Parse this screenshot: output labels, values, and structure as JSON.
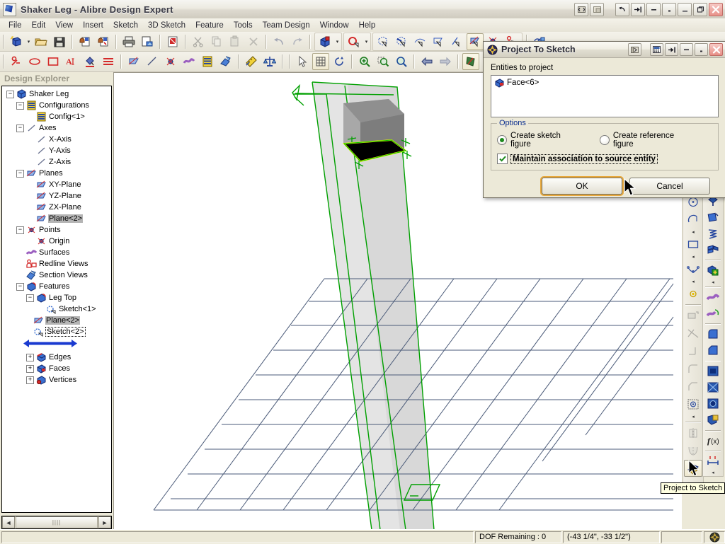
{
  "window": {
    "title": "Shaker Leg - Alibre Design Expert",
    "icon": "alibre-app-icon",
    "buttons": [
      "restore-split",
      "restore-window",
      "undo-arrow",
      "redo-pin",
      "minimize-small",
      "restore-small",
      "minimize",
      "maximize",
      "close"
    ]
  },
  "menubar": {
    "items": [
      {
        "label": "File",
        "key": "F"
      },
      {
        "label": "Edit",
        "key": "E"
      },
      {
        "label": "View",
        "key": "V"
      },
      {
        "label": "Insert",
        "key": "I"
      },
      {
        "label": "Sketch",
        "key": "k"
      },
      {
        "label": "3D Sketch",
        "key": "3"
      },
      {
        "label": "Feature",
        "key": "t"
      },
      {
        "label": "Tools",
        "key": "o"
      },
      {
        "label": "Team Design",
        "key": "D"
      },
      {
        "label": "Window",
        "key": "W"
      },
      {
        "label": "Help",
        "key": "H"
      }
    ]
  },
  "toolbar_row1": {
    "buttons": [
      {
        "name": "new-part-icon",
        "tooltip": "New"
      },
      {
        "name": "new-dropdown-caret",
        "tooltip": "New options"
      },
      {
        "name": "open-folder-icon",
        "tooltip": "Open"
      },
      {
        "name": "save-disk-icon",
        "tooltip": "Save"
      },
      {
        "name": "checkout-icon",
        "tooltip": "Check Out"
      },
      {
        "name": "checkin-icon",
        "tooltip": "Check In"
      },
      {
        "name": "print-icon",
        "tooltip": "Print"
      },
      {
        "name": "print-preview-icon",
        "tooltip": "Print Preview"
      },
      {
        "name": "pdf-export-icon",
        "tooltip": "Publish to PDF"
      },
      {
        "name": "cut-scissors-icon",
        "tooltip": "Cut"
      },
      {
        "name": "copy-icon",
        "tooltip": "Copy"
      },
      {
        "name": "paste-icon",
        "tooltip": "Paste"
      },
      {
        "name": "delete-x-icon",
        "tooltip": "Delete"
      },
      {
        "name": "undo-icon",
        "tooltip": "Undo"
      },
      {
        "name": "redo-icon",
        "tooltip": "Redo"
      },
      {
        "name": "select-box-icon",
        "tooltip": "Select"
      },
      {
        "name": "select-dropdown-caret",
        "tooltip": "Select options"
      },
      {
        "name": "sketch-mode-icon",
        "tooltip": "Activate 2D Sketch"
      },
      {
        "name": "sketch-dropdown-caret",
        "tooltip": "Sketch options"
      },
      {
        "name": "pick-face-icon",
        "tooltip": "Pick Face"
      },
      {
        "name": "pick-edge-icon",
        "tooltip": "Pick Edge"
      },
      {
        "name": "pick-vertex-icon",
        "tooltip": "Pick Vertex"
      },
      {
        "name": "pick-plane-icon",
        "tooltip": "Pick Plane"
      },
      {
        "name": "pick-axis-icon",
        "tooltip": "Pick Axis"
      },
      {
        "name": "pick-workplane-icon",
        "tooltip": "Pick Work Plane"
      },
      {
        "name": "pick-point-icon",
        "tooltip": "Pick Point"
      },
      {
        "name": "pick-annotation-icon",
        "tooltip": "Pick Annotation"
      },
      {
        "name": "global-view-icon",
        "tooltip": "Global View"
      }
    ]
  },
  "toolbar_row2": {
    "buttons": [
      {
        "name": "sketch-line-tool-icon",
        "tooltip": "Line"
      },
      {
        "name": "ellipse-tool-icon",
        "tooltip": "Ellipse"
      },
      {
        "name": "rectangle-tool-icon",
        "tooltip": "Rectangle"
      },
      {
        "name": "text-tool-icon",
        "tooltip": "Text"
      },
      {
        "name": "fill-color-icon",
        "tooltip": "Fill Color"
      },
      {
        "name": "line-style-icon",
        "tooltip": "Line Style"
      },
      {
        "name": "plane-icon",
        "tooltip": "Plane"
      },
      {
        "name": "axis-icon",
        "tooltip": "Axis"
      },
      {
        "name": "point-icon",
        "tooltip": "Point"
      },
      {
        "name": "surface-icon",
        "tooltip": "Surface"
      },
      {
        "name": "configurations-icon",
        "tooltip": "Configurations"
      },
      {
        "name": "section-view-icon",
        "tooltip": "Section View"
      },
      {
        "name": "measure-icon",
        "tooltip": "Measure"
      },
      {
        "name": "physical-properties-icon",
        "tooltip": "Physical Properties"
      },
      {
        "name": "pointer-select-icon",
        "tooltip": "Select"
      },
      {
        "name": "grid-snap-icon",
        "tooltip": "Snap to Grid"
      },
      {
        "name": "rotate-view-icon",
        "tooltip": "Rotate"
      },
      {
        "name": "zoom-in-icon",
        "tooltip": "Zoom In"
      },
      {
        "name": "zoom-window-icon",
        "tooltip": "Zoom Window"
      },
      {
        "name": "zoom-fit-icon",
        "tooltip": "Zoom to Fit"
      },
      {
        "name": "previous-view-icon",
        "tooltip": "Previous View"
      },
      {
        "name": "next-view-icon",
        "tooltip": "Next View"
      },
      {
        "name": "flip-normal-icon",
        "tooltip": "Flip Normal"
      },
      {
        "name": "face-normal-icon",
        "tooltip": "Face Normal"
      },
      {
        "name": "render-shaded-icon",
        "tooltip": "Shaded"
      }
    ]
  },
  "explorer": {
    "title": "Design Explorer",
    "scroll": {
      "left_arrow": "◄",
      "right_arrow": "►",
      "thumb_grip": "||||"
    },
    "tree": [
      {
        "label": "Shaker Leg",
        "indent": 0,
        "expander": "-",
        "icon": "part-icon",
        "state": "normal"
      },
      {
        "label": "Configurations",
        "indent": 1,
        "expander": "-",
        "icon": "configurations-icon",
        "state": "normal"
      },
      {
        "label": "Config<1>",
        "indent": 3,
        "expander": "none",
        "icon": "configurations-icon",
        "state": "normal"
      },
      {
        "label": "Axes",
        "indent": 1,
        "expander": "-",
        "icon": "axis-icon",
        "state": "normal"
      },
      {
        "label": "X-Axis",
        "indent": 3,
        "expander": "none",
        "icon": "axis-icon",
        "state": "normal"
      },
      {
        "label": "Y-Axis",
        "indent": 3,
        "expander": "none",
        "icon": "axis-icon",
        "state": "normal"
      },
      {
        "label": "Z-Axis",
        "indent": 3,
        "expander": "none",
        "icon": "axis-icon",
        "state": "normal"
      },
      {
        "label": "Planes",
        "indent": 1,
        "expander": "-",
        "icon": "plane-icon",
        "state": "normal"
      },
      {
        "label": "XY-Plane",
        "indent": 3,
        "expander": "none",
        "icon": "plane-icon",
        "state": "normal"
      },
      {
        "label": "YZ-Plane",
        "indent": 3,
        "expander": "none",
        "icon": "plane-icon",
        "state": "normal"
      },
      {
        "label": "ZX-Plane",
        "indent": 3,
        "expander": "none",
        "icon": "plane-icon",
        "state": "normal"
      },
      {
        "label": "Plane<2>",
        "indent": 3,
        "expander": "none",
        "icon": "plane-icon",
        "state": "selected"
      },
      {
        "label": "Points",
        "indent": 1,
        "expander": "-",
        "icon": "point-icon",
        "state": "normal"
      },
      {
        "label": "Origin",
        "indent": 3,
        "expander": "none",
        "icon": "point-icon",
        "state": "normal"
      },
      {
        "label": "Surfaces",
        "indent": 2,
        "expander": "none",
        "icon": "surface-icon",
        "state": "normal"
      },
      {
        "label": "Redline Views",
        "indent": 2,
        "expander": "none",
        "icon": "redline-icon",
        "state": "normal"
      },
      {
        "label": "Section Views",
        "indent": 2,
        "expander": "none",
        "icon": "section-icon",
        "state": "normal"
      },
      {
        "label": "Features",
        "indent": 1,
        "expander": "-",
        "icon": "feature-icon",
        "state": "normal"
      },
      {
        "label": "Leg Top",
        "indent": 2,
        "expander": "-",
        "icon": "feature-icon",
        "state": "normal"
      },
      {
        "label": "Sketch<1>",
        "indent": 4,
        "expander": "none",
        "icon": "sketch-icon",
        "state": "normal"
      },
      {
        "label": "Plane<2>",
        "indent": 3,
        "expander": "none",
        "icon": "plane-icon",
        "state": "selected"
      },
      {
        "label": "Sketch<2>",
        "indent": 3,
        "expander": "none",
        "icon": "sketch-icon",
        "state": "dotted"
      },
      {
        "label": "Edges",
        "indent": 0,
        "expander": "+",
        "icon": "edges-icon",
        "state": "normal"
      },
      {
        "label": "Faces",
        "indent": 0,
        "expander": "+",
        "icon": "faces-icon",
        "state": "normal"
      },
      {
        "label": "Vertices",
        "indent": 0,
        "expander": "+",
        "icon": "vertices-icon",
        "state": "normal"
      }
    ]
  },
  "dialog": {
    "title": "Project To Sketch",
    "icon": "alibre-dialog-icon",
    "titlebar_buttons": [
      "collapse-panel",
      "calculator",
      "pin",
      "minimize",
      "restore",
      "close"
    ],
    "entities_label": "Entities to project",
    "entities": [
      {
        "label": "Face<6>",
        "icon": "face-icon"
      }
    ],
    "options": {
      "group_label": "Options",
      "radios": [
        {
          "label": "Create sketch figure",
          "selected": true
        },
        {
          "label": "Create reference figure",
          "selected": false
        }
      ],
      "checkbox": {
        "label": "Maintain association to source entity",
        "checked": true
      }
    },
    "buttons": {
      "ok": "OK",
      "cancel": "Cancel"
    }
  },
  "right_toolbar_left": {
    "buttons": [
      {
        "name": "circle-center-icon"
      },
      {
        "name": "arc-icon"
      },
      {
        "name": "arc-caret-icon"
      },
      {
        "name": "rectangle-icon"
      },
      {
        "name": "rectangle-caret-icon"
      },
      {
        "name": "spline-icon"
      },
      {
        "name": "spline-caret-icon"
      },
      {
        "name": "reference-point-icon"
      },
      {
        "name": "offset-icon"
      },
      {
        "name": "trim-icon"
      },
      {
        "name": "extend-icon"
      },
      {
        "name": "fillet-corner-icon"
      },
      {
        "name": "chamfer-corner-icon"
      },
      {
        "name": "project-point-icon"
      },
      {
        "name": "project-caret-icon"
      },
      {
        "name": "mirror-icon"
      },
      {
        "name": "pattern-icon"
      },
      {
        "name": "project-to-sketch-icon"
      }
    ]
  },
  "right_toolbar_right": {
    "buttons": [
      {
        "name": "extrude-boss-icon"
      },
      {
        "name": "revolve-boss-icon"
      },
      {
        "name": "sweep-boss-icon"
      },
      {
        "name": "loft-boss-icon"
      },
      {
        "name": "add-material-icon"
      },
      {
        "name": "add-material-caret-icon"
      },
      {
        "name": "surface-loft-icon"
      },
      {
        "name": "surface-revolve-icon"
      },
      {
        "name": "fillet-icon"
      },
      {
        "name": "chamfer-icon"
      },
      {
        "name": "shell-icon"
      },
      {
        "name": "draft-icon"
      },
      {
        "name": "hole-icon"
      },
      {
        "name": "thread-icon"
      },
      {
        "name": "equation-icon"
      },
      {
        "name": "dimension-icon"
      },
      {
        "name": "dimension-caret-icon"
      }
    ]
  },
  "tooltip": {
    "text": "Project to Sketch"
  },
  "statusbar": {
    "dof": "DOF Remaining : 0",
    "coordinates": "(-43 1/4\", -33 1/2\")",
    "app_icon": "alibre-status-icon"
  },
  "viewport": {
    "colors": {
      "grid_line": "#4a5a78",
      "sketch_green": "#00a000",
      "highlight_yellow": "#ffff00",
      "solid_light": "#b4b4b4",
      "solid_dark": "#787878",
      "solid_black": "#000000",
      "plane_fill": "#e0e0e0",
      "background": "#ffffff"
    }
  }
}
